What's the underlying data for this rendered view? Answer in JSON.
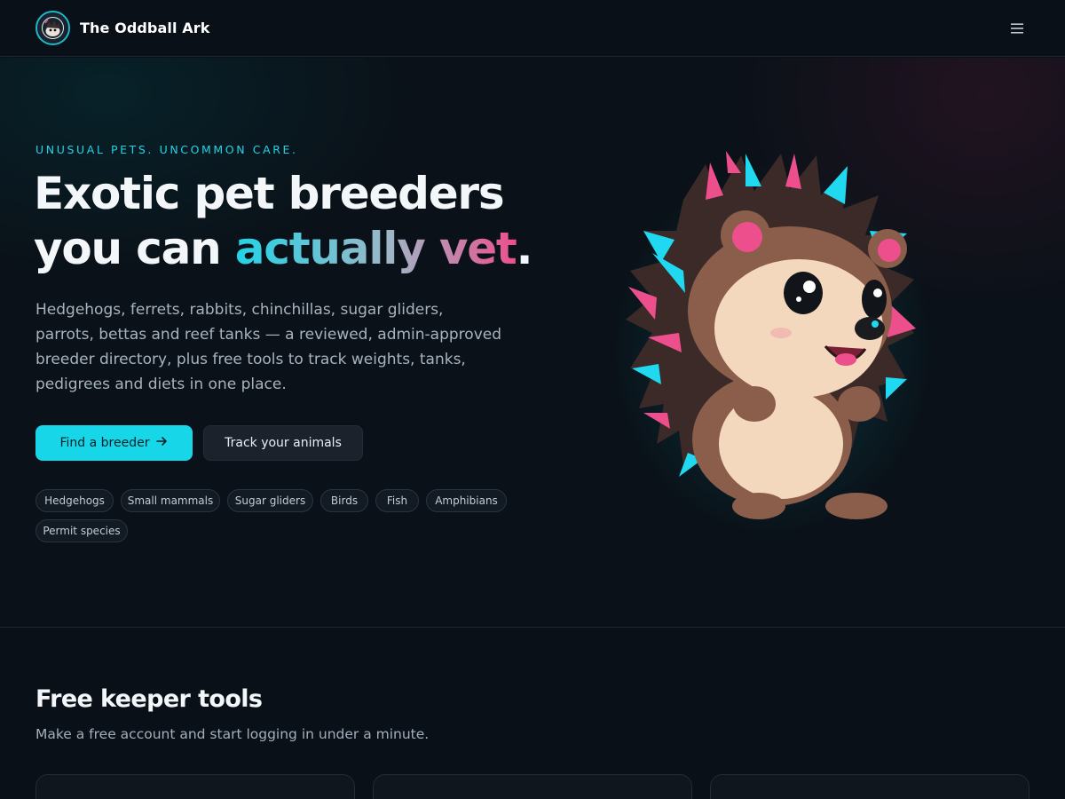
{
  "header": {
    "brand_name": "The Oddball Ark",
    "menu_icon": "menu-icon"
  },
  "hero": {
    "eyebrow": "UNUSUAL PETS. UNCOMMON CARE.",
    "headline_line1": "Exotic pet breeders",
    "headline_line2_prefix": "you can ",
    "headline_highlight": "actually vet",
    "headline_period": ".",
    "lead": "Hedgehogs, ferrets, rabbits, chinchillas, sugar gliders, parrots, bettas and reef tanks — a reviewed, admin-approved breeder directory, plus free tools to track weights, tanks, pedigrees and diets in one place.",
    "primary_button": "Find a breeder",
    "secondary_button": "Track your animals",
    "chips": [
      "Hedgehogs",
      "Small mammals",
      "Sugar gliders",
      "Birds",
      "Fish",
      "Amphibians",
      "Permit species"
    ]
  },
  "tools": {
    "title": "Free keeper tools",
    "subtitle": "Make a free account and start logging in under a minute."
  },
  "colors": {
    "accent": "#16d6e8",
    "pink": "#ec4f8c",
    "background": "#0a1018"
  }
}
